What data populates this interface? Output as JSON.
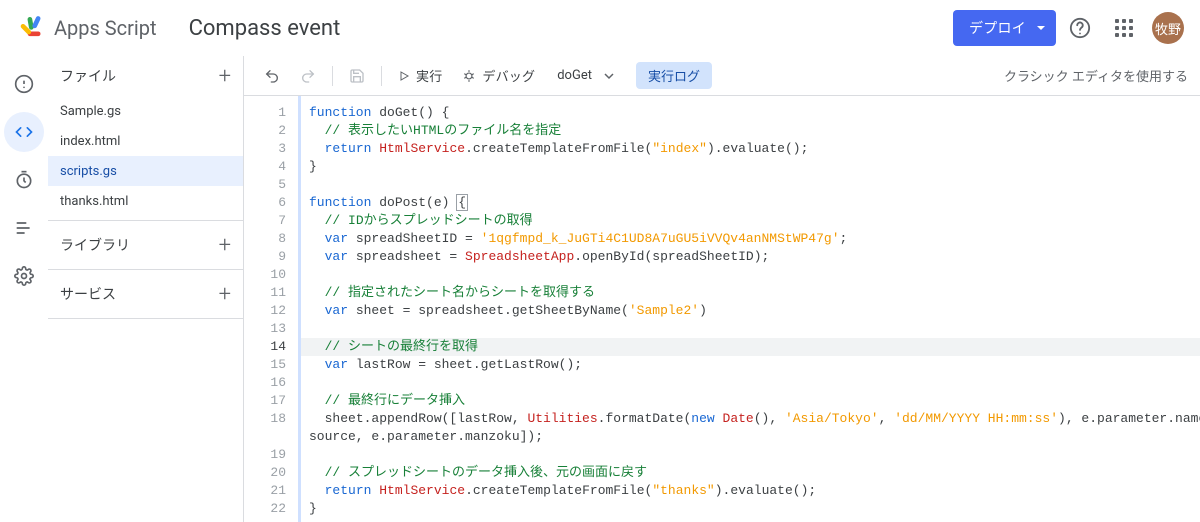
{
  "header": {
    "brand": "Apps Script",
    "project_title": "Compass event",
    "deploy_label": "デプロイ",
    "avatar_initials": "牧野"
  },
  "rail": {
    "items": [
      "info",
      "editor",
      "triggers",
      "executions",
      "settings"
    ],
    "active": "editor"
  },
  "sidebar": {
    "files_label": "ファイル",
    "files": [
      {
        "name": "Sample.gs"
      },
      {
        "name": "index.html"
      },
      {
        "name": "scripts.gs",
        "selected": true
      },
      {
        "name": "thanks.html"
      }
    ],
    "libraries_label": "ライブラリ",
    "services_label": "サービス"
  },
  "toolbar": {
    "run_label": "実行",
    "debug_label": "デバッグ",
    "function_selected": "doGet",
    "exec_log_label": "実行ログ",
    "classic_editor_label": "クラシック エディタを使用する"
  },
  "editor": {
    "current_line": 14,
    "line_numbers": [
      1,
      2,
      3,
      4,
      5,
      6,
      7,
      8,
      9,
      10,
      11,
      12,
      13,
      14,
      15,
      16,
      17,
      18,
      "",
      19,
      20,
      21,
      22
    ],
    "lines": [
      {
        "t": [
          [
            "kw",
            "function"
          ],
          [
            "id",
            " doGet"
          ],
          [
            "pun",
            "() {"
          ]
        ]
      },
      {
        "i": 1,
        "t": [
          [
            "com",
            "// 表示したいHTMLのファイル名を指定"
          ]
        ]
      },
      {
        "i": 1,
        "t": [
          [
            "kw",
            "return"
          ],
          [
            "id",
            " "
          ],
          [
            "fn",
            "HtmlService"
          ],
          [
            "pun",
            "."
          ],
          [
            "id",
            "createTemplateFromFile"
          ],
          [
            "pun",
            "("
          ],
          [
            "str",
            "\"index\""
          ],
          [
            "pun",
            ")."
          ],
          [
            "id",
            "evaluate"
          ],
          [
            "pun",
            "();"
          ]
        ]
      },
      {
        "t": [
          [
            "pun",
            "}"
          ]
        ]
      },
      {
        "t": []
      },
      {
        "t": [
          [
            "kw",
            "function"
          ],
          [
            "id",
            " doPost"
          ],
          [
            "pun",
            "(e) {"
          ]
        ],
        "cursor": true
      },
      {
        "i": 1,
        "t": [
          [
            "com",
            "// IDからスプレッドシートの取得"
          ]
        ]
      },
      {
        "i": 1,
        "t": [
          [
            "kw",
            "var"
          ],
          [
            "id",
            " spreadSheetID = "
          ],
          [
            "str",
            "'1qgfmpd_k_JuGTi4C1UD8A7uGU5iVVQv4anNMStWP47g'"
          ],
          [
            "pun",
            ";"
          ]
        ]
      },
      {
        "i": 1,
        "t": [
          [
            "kw",
            "var"
          ],
          [
            "id",
            " spreadsheet = "
          ],
          [
            "fn",
            "SpreadsheetApp"
          ],
          [
            "pun",
            "."
          ],
          [
            "id",
            "openById"
          ],
          [
            "pun",
            "(spreadSheetID);"
          ]
        ]
      },
      {
        "t": []
      },
      {
        "i": 1,
        "t": [
          [
            "com",
            "// 指定されたシート名からシートを取得する"
          ]
        ]
      },
      {
        "i": 1,
        "t": [
          [
            "kw",
            "var"
          ],
          [
            "id",
            " sheet = spreadsheet.getSheetByName("
          ],
          [
            "str",
            "'Sample2'"
          ],
          [
            "pun",
            ")"
          ]
        ]
      },
      {
        "t": []
      },
      {
        "i": 1,
        "hl": true,
        "t": [
          [
            "com",
            "// シートの最終行を取得"
          ]
        ]
      },
      {
        "i": 1,
        "t": [
          [
            "kw",
            "var"
          ],
          [
            "id",
            " lastRow = sheet.getLastRow();"
          ]
        ]
      },
      {
        "t": []
      },
      {
        "i": 1,
        "t": [
          [
            "com",
            "// 最終行にデータ挿入"
          ]
        ]
      },
      {
        "i": 1,
        "t": [
          [
            "id",
            "sheet.appendRow([lastRow, "
          ],
          [
            "fn",
            "Utilities"
          ],
          [
            "id",
            ".formatDate("
          ],
          [
            "kw",
            "new"
          ],
          [
            "id",
            " "
          ],
          [
            "fn",
            "Date"
          ],
          [
            "pun",
            "(), "
          ],
          [
            "str",
            "'Asia/Tokyo'"
          ],
          [
            "pun",
            ", "
          ],
          [
            "str",
            "'dd/MM/YYYY HH:mm:ss'"
          ],
          [
            "pun",
            "), e.parameter.name, e.parameter."
          ]
        ]
      },
      {
        "t": [
          [
            "id",
            "source, e.parameter.manzoku]);"
          ]
        ]
      },
      {
        "t": []
      },
      {
        "i": 1,
        "t": [
          [
            "com",
            "// スプレッドシートのデータ挿入後、元の画面に戻す"
          ]
        ]
      },
      {
        "i": 1,
        "t": [
          [
            "kw",
            "return"
          ],
          [
            "id",
            " "
          ],
          [
            "fn",
            "HtmlService"
          ],
          [
            "pun",
            "."
          ],
          [
            "id",
            "createTemplateFromFile"
          ],
          [
            "pun",
            "("
          ],
          [
            "str",
            "\"thanks\""
          ],
          [
            "pun",
            ")."
          ],
          [
            "id",
            "evaluate"
          ],
          [
            "pun",
            "();"
          ]
        ]
      },
      {
        "t": [
          [
            "pun",
            "}"
          ]
        ]
      }
    ]
  }
}
